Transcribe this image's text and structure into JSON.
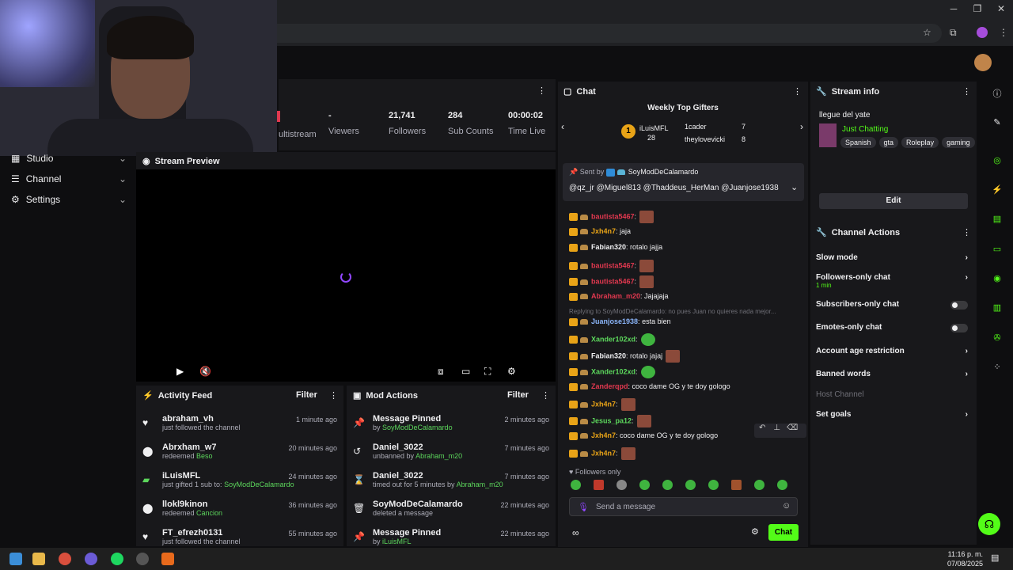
{
  "stats": [
    {
      "value": "-",
      "label": "Viewers"
    },
    {
      "value": "21,741",
      "label": "Followers"
    },
    {
      "value": "284",
      "label": "Sub Counts"
    },
    {
      "value": "00:00:02",
      "label": "Time Live"
    }
  ],
  "multistream_partial": "ultistream",
  "nav": {
    "studio": "Studio",
    "channel": "Channel",
    "settings": "Settings"
  },
  "preview": {
    "title": "Stream Preview"
  },
  "activity": {
    "title": "Activity Feed",
    "filter": "Filter",
    "items": [
      {
        "name": "abraham_vh",
        "sub": "just followed the channel",
        "time": "1 minute ago"
      },
      {
        "name": "Abrxham_w7",
        "sub": "redeemed",
        "sub2": "Beso",
        "time": "20 minutes ago"
      },
      {
        "name": "iLuisMFL",
        "sub": "just gifted 1 sub to:",
        "sub2": "SoyModDeCalamardo",
        "time": "24 minutes ago"
      },
      {
        "name": "llokl9kinon",
        "sub": "redeemed",
        "sub2": "Cancion",
        "time": "36 minutes ago"
      },
      {
        "name": "FT_efrezh0131",
        "sub": "just followed the channel",
        "time": "55 minutes ago"
      }
    ]
  },
  "modactions": {
    "title": "Mod Actions",
    "filter": "Filter",
    "items": [
      {
        "name": "Message Pinned",
        "sub": "by",
        "sub2": "SoyModDeCalamardo",
        "time": "2 minutes ago"
      },
      {
        "name": "Daniel_3022",
        "sub": "unbanned by",
        "sub2": "Abraham_m20",
        "time": "7 minutes ago"
      },
      {
        "name": "Daniel_3022",
        "sub": "timed out for 5 minutes by",
        "sub2": "Abraham_m20",
        "time": "7 minutes ago"
      },
      {
        "name": "SoyModDeCalamardo",
        "sub": "deleted a message",
        "time": "22 minutes ago"
      },
      {
        "name": "Message Pinned",
        "sub": "by",
        "sub2": "iLuisMFL",
        "time": "22 minutes ago"
      }
    ]
  },
  "chat": {
    "title": "Chat",
    "gifters_title": "Weekly Top Gifters",
    "gifters": [
      {
        "rank": "1",
        "name": "iLuisMFL",
        "count": "28"
      },
      {
        "name": "1cader",
        "count": "7"
      },
      {
        "name": "theylovevicki",
        "count": "8"
      }
    ],
    "pinned_by": "Sent by",
    "pinned_user": "SoyModDeCalamardo",
    "pinned_msg": "@qz_jr @Miguel813 @Thaddeus_HerMan @Juanjose1938",
    "messages": [
      {
        "user": "bautista5467",
        "text": "",
        "color": "#e0384f"
      },
      {
        "user": "Jxh4n7",
        "text": " jaja",
        "color": "#e8a317"
      },
      {
        "user": "Fabian320",
        "text": " rotalo jajja",
        "color": "#efeff1"
      },
      {
        "user": "bautista5467",
        "text": "",
        "color": "#e0384f"
      },
      {
        "user": "bautista5467",
        "text": "",
        "color": "#e0384f"
      },
      {
        "user": "Abraham_m20",
        "text": " Jajajaja",
        "color": "#e0384f"
      },
      {
        "reply": "Replying to SoyModDeCalamardo: no pues Juan no quieres nada mejor..."
      },
      {
        "user": "Juanjose1938",
        "text": " esta bien",
        "color": "#8ab4f8"
      },
      {
        "user": "Xander102xd",
        "text": "",
        "color": "#5cd65c"
      },
      {
        "user": "Fabian320",
        "text": " rotalo jajaj",
        "color": "#efeff1"
      },
      {
        "user": "Xander102xd",
        "text": "",
        "color": "#5cd65c"
      },
      {
        "user": "Zanderqpd",
        "text": " coco dame OG y te doy gologo",
        "color": "#e0384f"
      },
      {
        "user": "Jxh4n7",
        "text": "",
        "color": "#e8a317"
      },
      {
        "user": "Jesus_pa12",
        "text": "",
        "color": "#5cd65c"
      },
      {
        "user": "Jxh4n7",
        "text": " coco dame OG y te doy gologo",
        "color": "#e8a317"
      },
      {
        "user": "Jxh4n7",
        "text": "",
        "color": "#e8a317"
      }
    ],
    "followers_only": "Followers only",
    "placeholder": "Send a message",
    "send": "Chat"
  },
  "streaminfo": {
    "title": "Stream info",
    "stream_title": "llegue del yate",
    "category": "Just Chatting",
    "tags": [
      "Spanish",
      "gta",
      "Roleplay",
      "gaming"
    ],
    "edit": "Edit"
  },
  "chanactions": {
    "title": "Channel Actions",
    "items": [
      {
        "label": "Slow mode"
      },
      {
        "label": "Followers-only chat",
        "sub": "1 min"
      },
      {
        "label": "Subscribers-only chat"
      },
      {
        "label": "Emotes-only chat"
      },
      {
        "label": "Account age restriction"
      },
      {
        "label": "Banned words"
      },
      {
        "label": "Host Channel"
      },
      {
        "label": "Set goals"
      }
    ]
  },
  "taskbar": {
    "time": "11:16 p. m.",
    "date": "07/08/2025"
  }
}
